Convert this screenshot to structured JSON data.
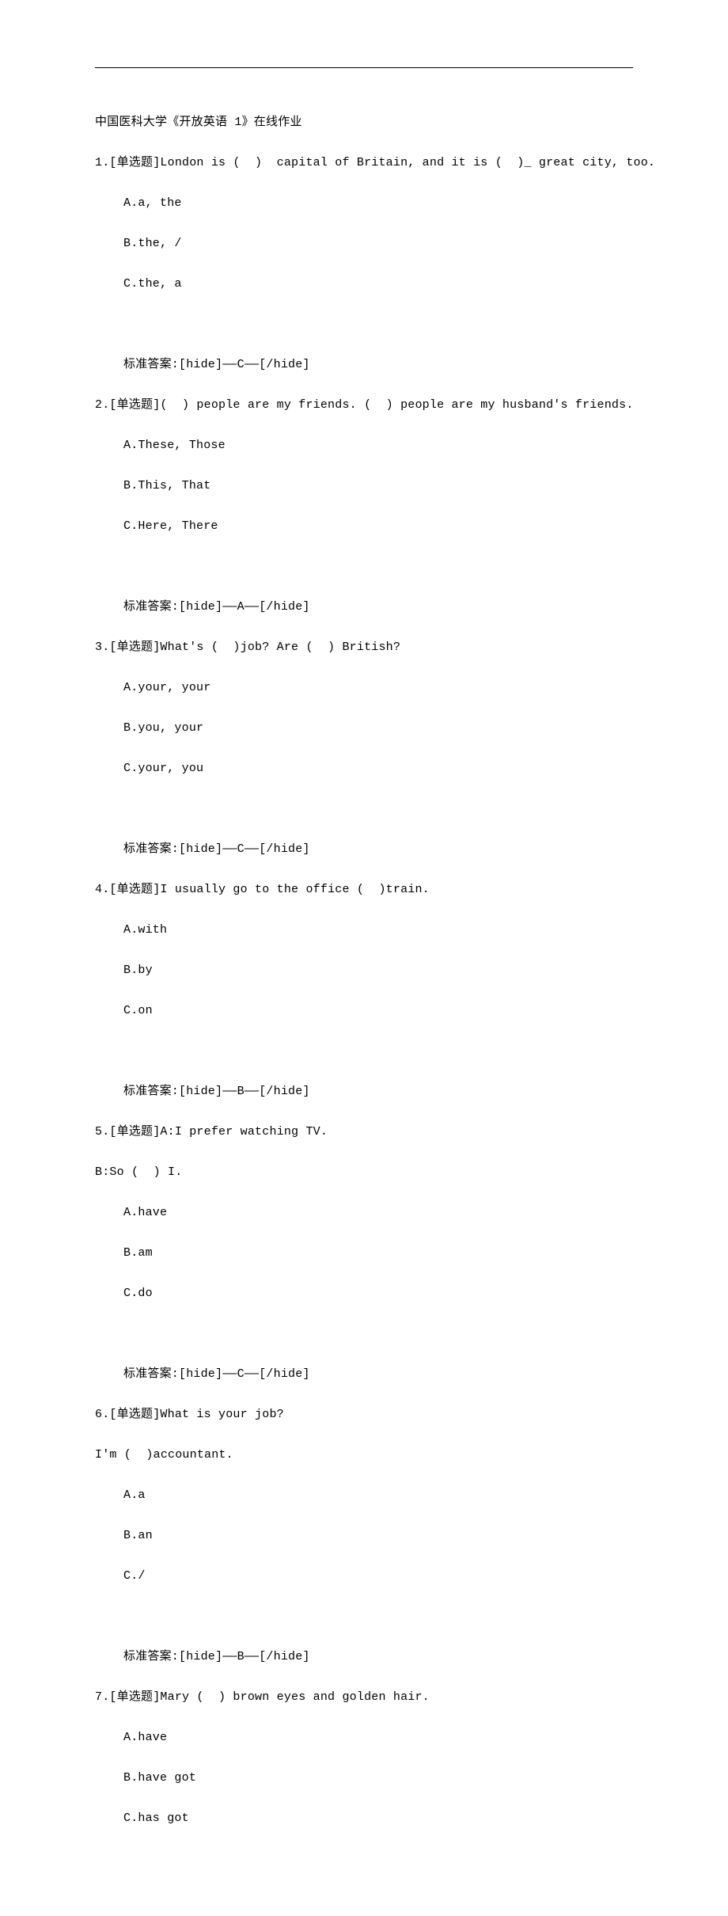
{
  "title": "中国医科大学《开放英语 1》在线作业",
  "questions": [
    {
      "num": "1",
      "type": "[单选题]",
      "stem": "London is (  )  capital of Britain, and it is (  )_ great city, too.",
      "sub": "",
      "opts": [
        "A.a, the",
        "B.the, /",
        "C.the, a"
      ],
      "answer": "标准答案:[hide]——C——[/hide]"
    },
    {
      "num": "2",
      "type": "[单选题]",
      "stem": "(  ) people are my friends. (  ) people are my husband's friends.",
      "sub": "",
      "opts": [
        "A.These, Those",
        "B.This, That",
        "C.Here, There"
      ],
      "answer": "标准答案:[hide]——A——[/hide]"
    },
    {
      "num": "3",
      "type": "[单选题]",
      "stem": "What's (  )job? Are (  ) British?",
      "sub": "",
      "opts": [
        "A.your, your",
        "B.you, your",
        "C.your, you"
      ],
      "answer": "标准答案:[hide]——C——[/hide]"
    },
    {
      "num": "4",
      "type": "[单选题]",
      "stem": "I usually go to the office (  )train.",
      "sub": "",
      "opts": [
        "A.with",
        "B.by",
        "C.on"
      ],
      "answer": "标准答案:[hide]——B——[/hide]"
    },
    {
      "num": "5",
      "type": "[单选题]",
      "stem": "A:I prefer watching TV.",
      "sub": "B:So (  ) I.",
      "opts": [
        "A.have",
        "B.am",
        "C.do"
      ],
      "answer": "标准答案:[hide]——C——[/hide]"
    },
    {
      "num": "6",
      "type": "[单选题]",
      "stem": "What is your job?",
      "sub": "I'm (  )accountant.",
      "opts": [
        "A.a",
        "B.an",
        "C./"
      ],
      "answer": "标准答案:[hide]——B——[/hide]"
    },
    {
      "num": "7",
      "type": "[单选题]",
      "stem": "Mary (  ) brown eyes and golden hair.",
      "sub": "",
      "opts": [
        "A.have",
        "B.have got",
        "C.has got"
      ],
      "answer": ""
    }
  ]
}
